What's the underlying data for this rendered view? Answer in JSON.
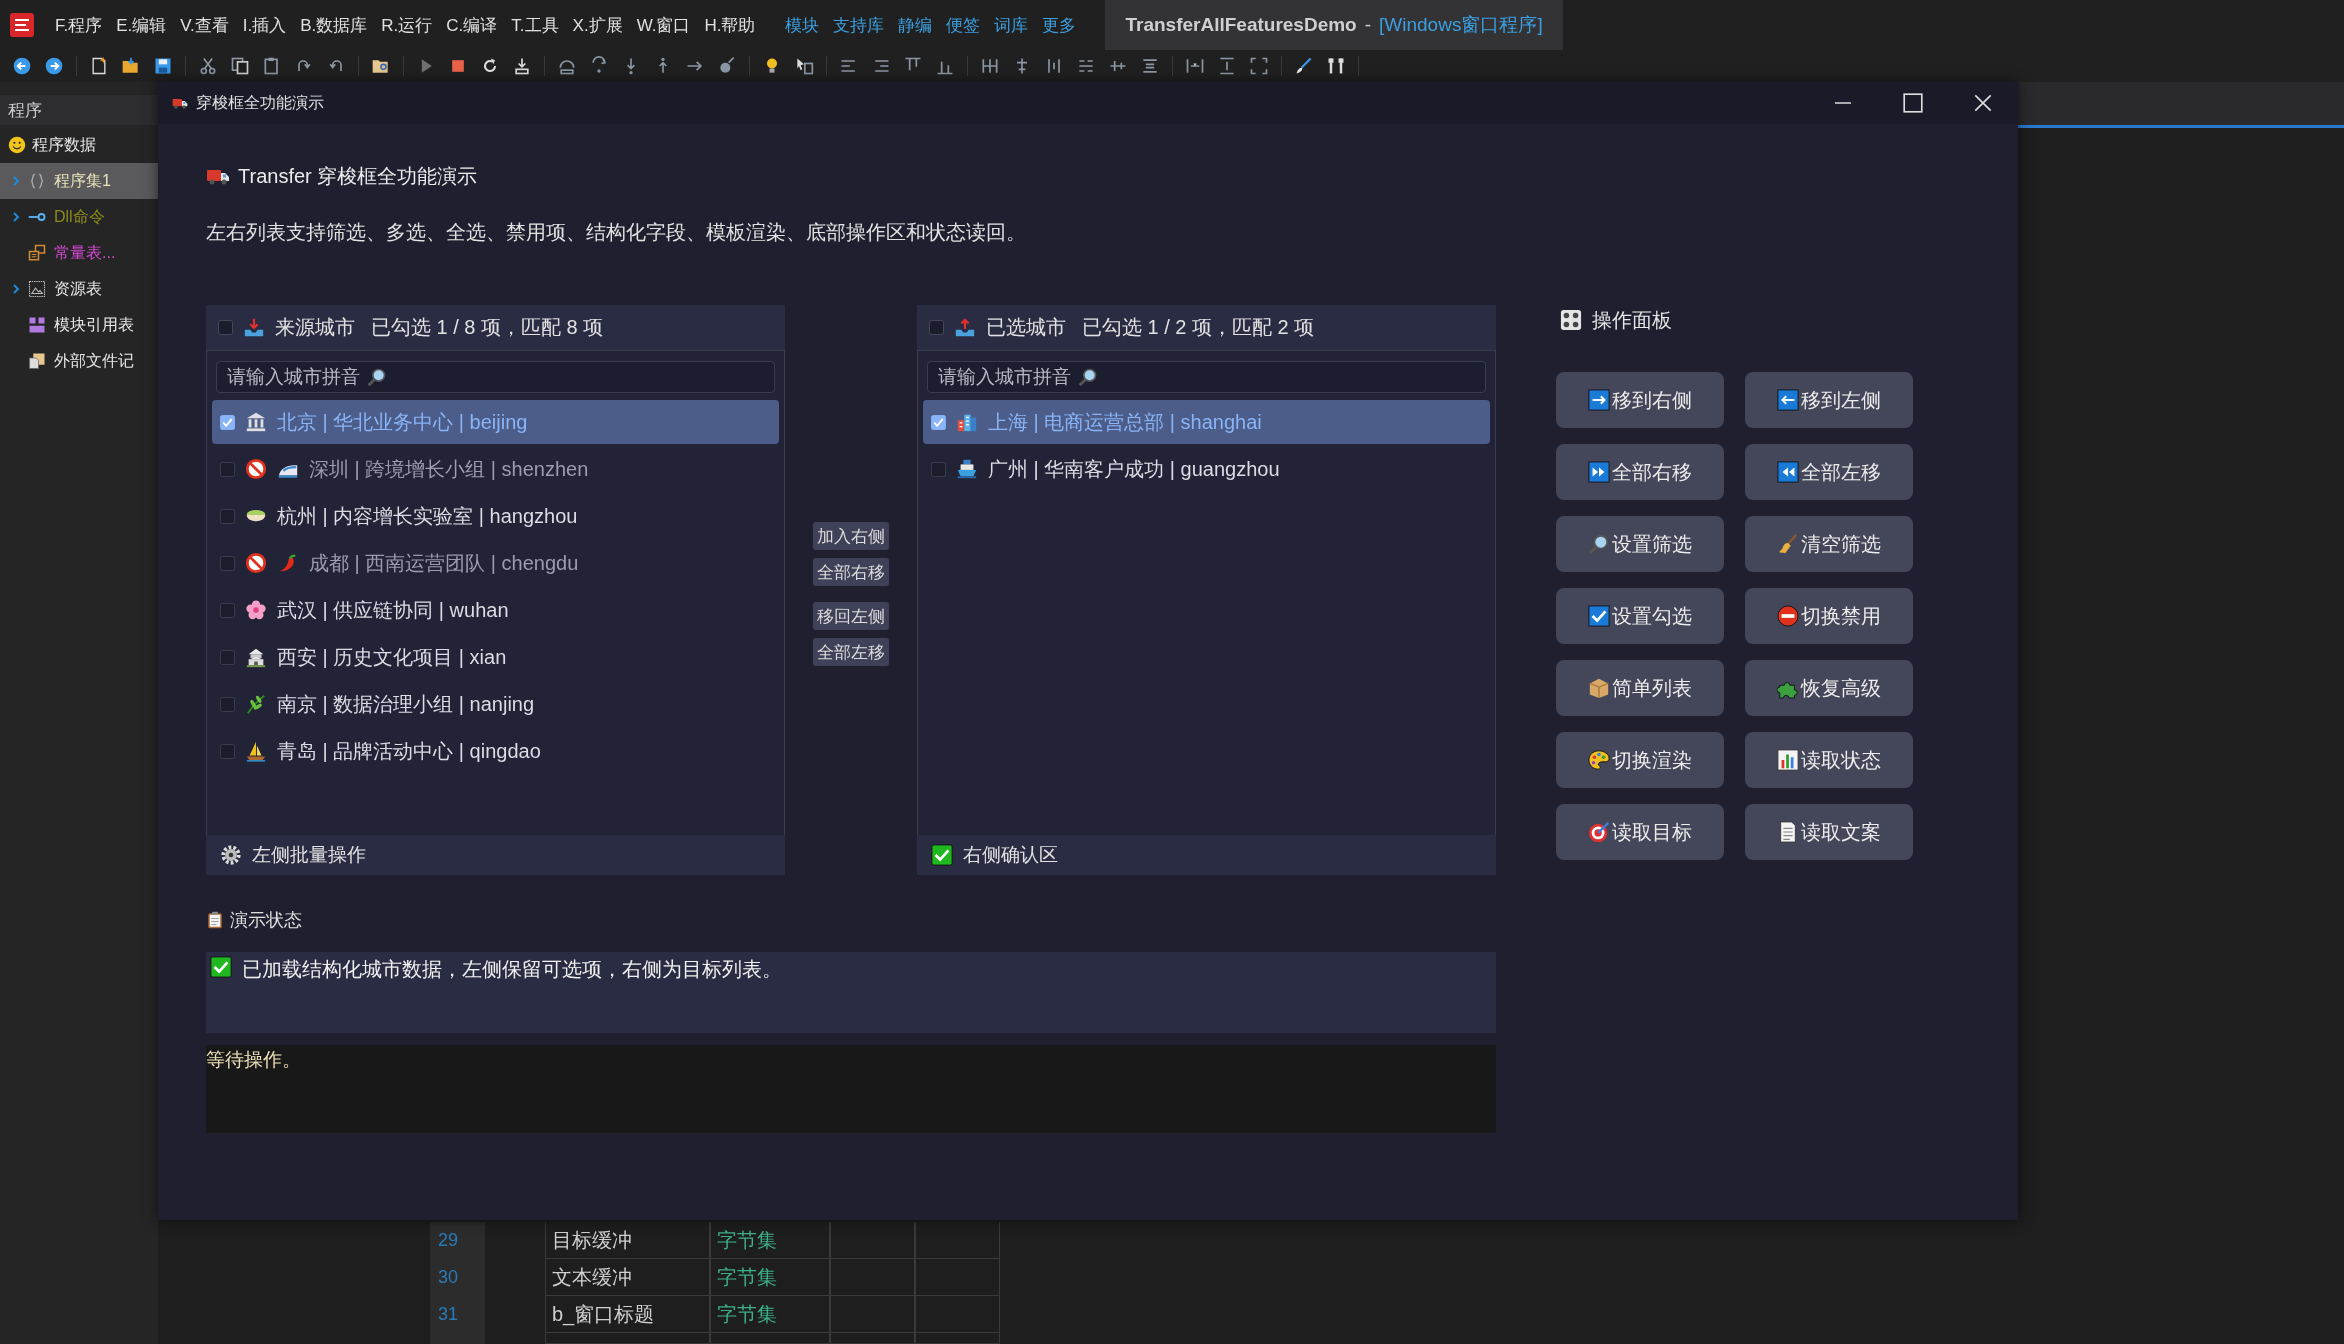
{
  "menubar": {
    "menus": [
      "F.程序",
      "E.编辑",
      "V.查看",
      "I.插入",
      "B.数据库",
      "R.运行",
      "C.编译",
      "T.工具",
      "X.扩展",
      "W.窗口",
      "H.帮助"
    ],
    "links": [
      "模块",
      "支持库",
      "静编",
      "便签",
      "词库",
      "更多"
    ],
    "project": "TransferAllFeaturesDemo",
    "separator": "-",
    "mode": "[Windows窗口程序]"
  },
  "sidebar": {
    "title": "程序",
    "root": {
      "label": "程序数据",
      "color": "#e6e6e6",
      "children": [
        {
          "label": "程序集1",
          "expanded": false,
          "selected": true,
          "color": "#e8e2b8"
        },
        {
          "label": "Dll命令",
          "expanded": false,
          "selected": false,
          "color": "#8c8c1c"
        },
        {
          "label": "常量表...",
          "selected": false,
          "color": "#d24ad2"
        },
        {
          "label": "资源表",
          "expanded": false,
          "selected": false,
          "color": "#e6e6e6"
        },
        {
          "label": "模块引用表",
          "selected": false,
          "color": "#e6e6e6"
        },
        {
          "label": "外部文件记",
          "selected": false,
          "color": "#e6e6e6"
        }
      ]
    }
  },
  "dialog": {
    "title": "穿梭框全功能演示",
    "heading": "Transfer 穿梭框全功能演示",
    "description": "左右列表支持筛选、多选、全选、禁用项、结构化字段、模板渲染、底部操作区和状态读回。",
    "left_panel": {
      "title": "来源城市",
      "summary": "已勾选 1 / 8 项，匹配 8 项",
      "all_checked": false,
      "search": {
        "placeholder": "请输入城市拼音"
      },
      "items": [
        {
          "text": "北京 | 华北业务中心 | beijing",
          "checked": true,
          "disabled": false
        },
        {
          "text": "深圳 | 跨境增长小组 | shenzhen",
          "checked": false,
          "disabled": true
        },
        {
          "text": "杭州 | 内容增长实验室 | hangzhou",
          "checked": false,
          "disabled": false
        },
        {
          "text": "成都 | 西南运营团队 | chengdu",
          "checked": false,
          "disabled": true
        },
        {
          "text": "武汉 | 供应链协同 | wuhan",
          "checked": false,
          "disabled": false
        },
        {
          "text": "西安 | 历史文化项目 | xian",
          "checked": false,
          "disabled": false
        },
        {
          "text": "南京 | 数据治理小组 | nanjing",
          "checked": false,
          "disabled": false
        },
        {
          "text": "青岛 | 品牌活动中心 | qingdao",
          "checked": false,
          "disabled": false
        }
      ],
      "footer": "左侧批量操作"
    },
    "transfer_buttons": [
      "加入右侧",
      "全部右移",
      "移回左侧",
      "全部左移"
    ],
    "right_panel": {
      "title": "已选城市",
      "summary": "已勾选 1 / 2 项，匹配 2 项",
      "all_checked": false,
      "search": {
        "placeholder": "请输入城市拼音"
      },
      "items": [
        {
          "text": "上海 | 电商运营总部 | shanghai",
          "checked": true,
          "disabled": false
        },
        {
          "text": "广州 | 华南客户成功 | guangzhou",
          "checked": false,
          "disabled": false
        }
      ],
      "footer": "右侧确认区"
    },
    "operations": {
      "title": "操作面板",
      "buttons": [
        "移到右侧",
        "移到左侧",
        "全部右移",
        "全部左移",
        "设置筛选",
        "清空筛选",
        "设置勾选",
        "切换禁用",
        "简单列表",
        "恢复高级",
        "切换渲染",
        "读取状态",
        "读取目标",
        "读取文案"
      ]
    },
    "status": {
      "label": "演示状态",
      "message": "已加载结构化城市数据，左侧保留可选项，右侧为目标列表。",
      "log": "等待操作。"
    }
  },
  "code_table": {
    "rows": [
      {
        "line": "29",
        "name": "目标缓冲",
        "type": "字节集"
      },
      {
        "line": "30",
        "name": "文本缓冲",
        "type": "字节集"
      },
      {
        "line": "31",
        "name": "b_窗口标题",
        "type": "字节集"
      }
    ]
  }
}
